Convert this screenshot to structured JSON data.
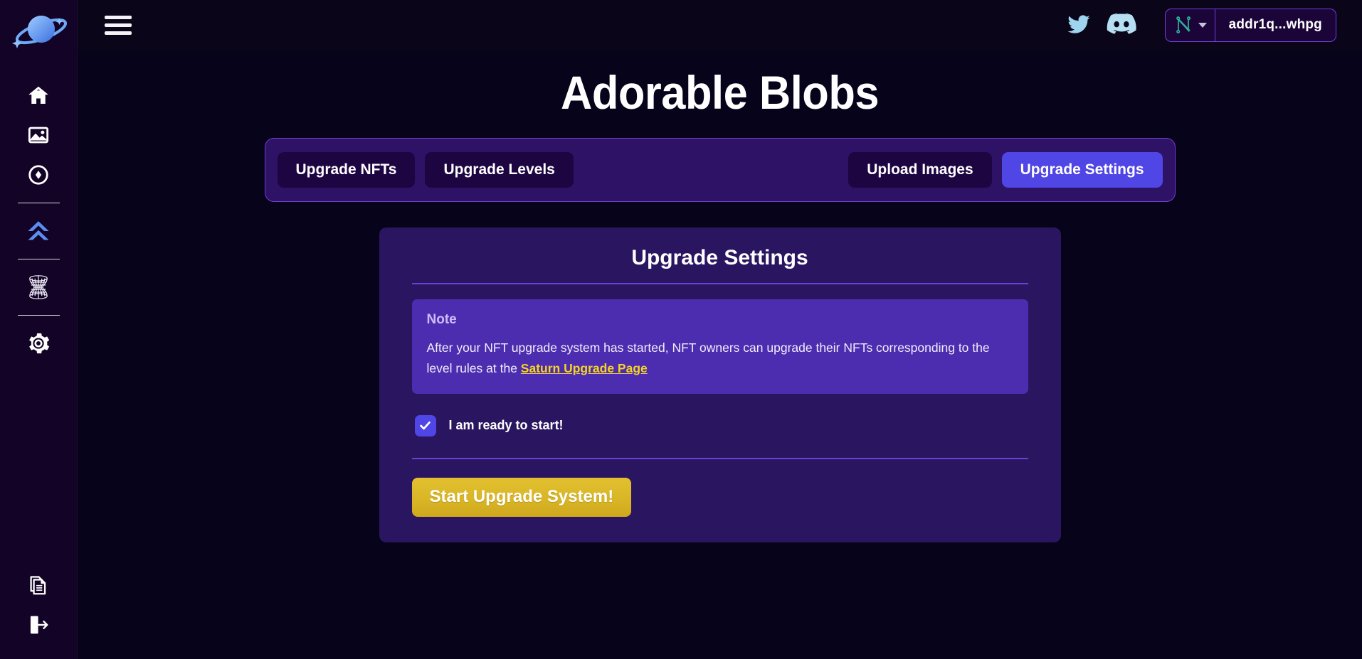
{
  "sidebar": {
    "logo_icon": "saturn-planet-logo",
    "top_items": [
      {
        "icon": "home-icon",
        "label": "Home",
        "active": false
      },
      {
        "icon": "image-gallery-icon",
        "label": "Images",
        "active": false
      },
      {
        "icon": "token-circle-icon",
        "label": "Token",
        "active": false
      }
    ],
    "mid_items": [
      {
        "icon": "double-chevron-up-icon",
        "label": "Upgrade",
        "active": true
      }
    ],
    "wormhole_items": [
      {
        "icon": "wormhole-icon",
        "label": "Wormhole",
        "active": false
      }
    ],
    "settings_items": [
      {
        "icon": "gear-icon",
        "label": "Settings",
        "active": false
      }
    ],
    "bottom_items": [
      {
        "icon": "documents-icon",
        "label": "Documents",
        "active": false
      },
      {
        "icon": "logout-icon",
        "label": "Logout",
        "active": false
      }
    ]
  },
  "topbar": {
    "menu_icon": "hamburger-menu-icon",
    "twitter_icon": "twitter-bird-icon",
    "discord_icon": "discord-logo-icon",
    "wallet": {
      "wallet_icon": "nami-wallet-icon",
      "chevron_icon": "chevron-down-icon",
      "address": "addr1q...whpg"
    }
  },
  "page": {
    "title": "Adorable Blobs"
  },
  "tabs": [
    {
      "label": "Upgrade NFTs",
      "active": false
    },
    {
      "label": "Upgrade Levels",
      "active": false
    },
    {
      "label": "Upload Images",
      "active": false
    },
    {
      "label": "Upgrade Settings",
      "active": true
    }
  ],
  "card": {
    "title": "Upgrade Settings",
    "note": {
      "heading": "Note",
      "body_before": "After your NFT upgrade system has started, NFT owners can upgrade their NFTs corresponding to the level rules at the ",
      "link_text": "Saturn Upgrade Page"
    },
    "checkbox": {
      "label": "I am ready to start!",
      "checked": true,
      "check_icon": "checkmark-icon"
    },
    "start_button": "Start Upgrade System!"
  },
  "colors": {
    "page_bg": "#07031a",
    "sidebar_bg": "#130327",
    "accent_indigo": "#4f46e5",
    "card_bg": "#2a1660",
    "note_bg": "#4c2db0",
    "divider_purple": "#6d3fd6",
    "link_yellow": "#f5d329",
    "button_gold": "#d9b626",
    "icon_blue": "#5b8cf0",
    "wallet_teal": "#2fb39a"
  }
}
